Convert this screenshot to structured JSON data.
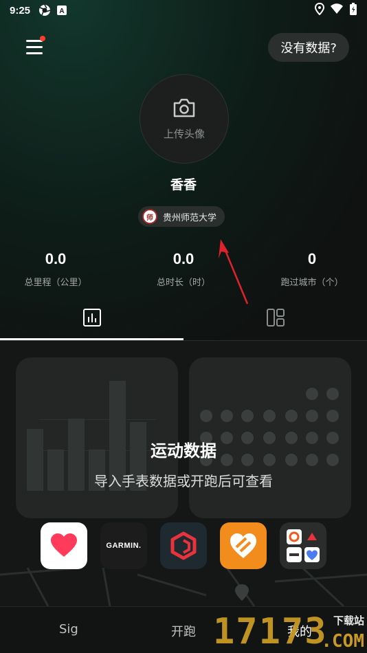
{
  "status_bar": {
    "time": "9:25"
  },
  "header": {
    "nodata_label": "没有数据?"
  },
  "profile": {
    "upload_label": "上传头像",
    "username": "香香",
    "school": "贵州师范大学",
    "school_logo_char": "师"
  },
  "stats": [
    {
      "value": "0.0",
      "label": "总里程（公里）"
    },
    {
      "value": "0.0",
      "label": "总时长（时）"
    },
    {
      "value": "0",
      "label": "跑过城市（个）"
    }
  ],
  "tabs": [
    {
      "icon": "bar-chart-icon",
      "active": true
    },
    {
      "icon": "grid-layout-icon",
      "active": false
    }
  ],
  "overlay": {
    "title": "运动数据",
    "subtitle": "导入手表数据或开跑后可查看"
  },
  "apps": [
    {
      "name": "health-app-icon",
      "text": ""
    },
    {
      "name": "garmin-app-icon",
      "text": "GARMIN."
    },
    {
      "name": "coros-app-icon",
      "text": ""
    },
    {
      "name": "huawei-health-app-icon",
      "text": ""
    },
    {
      "name": "more-apps-icon",
      "text": ""
    }
  ],
  "bottom_nav": [
    {
      "label": "Sig"
    },
    {
      "label": "开跑"
    },
    {
      "label": "我的"
    }
  ],
  "watermark": {
    "number": "17173",
    "site": "下载站",
    "domain": ".COM"
  },
  "colors": {
    "accent_red": "#ff3b30",
    "arrow_red": "#e0232a",
    "watermark_gold": "#c89a24"
  }
}
